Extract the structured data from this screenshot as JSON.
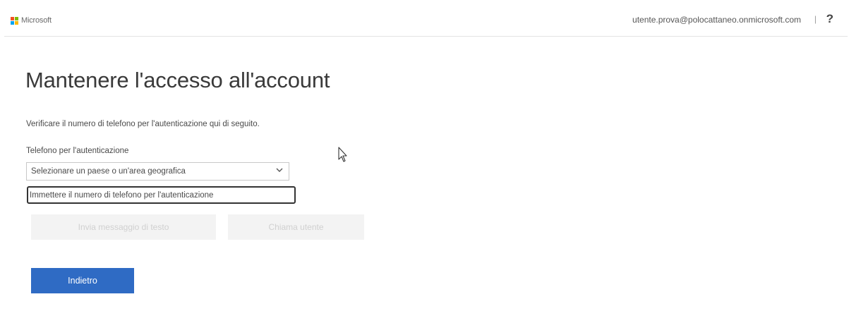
{
  "header": {
    "brand": "Microsoft",
    "user_email": "utente.prova@polocattaneo.onmicrosoft.com",
    "separator": "|",
    "help": "?"
  },
  "main": {
    "title": "Mantenere l'accesso all'account",
    "description": "Verificare il numero di telefono per l'autenticazione qui di seguito.",
    "phone_label": "Telefono per l'autenticazione",
    "country_select": {
      "value": "Selezionare un paese o un'area geografica"
    },
    "phone_input": {
      "value": "",
      "placeholder": "Immettere il numero di telefono per l'autenticazione"
    },
    "buttons": {
      "send_text": "Invia messaggio di testo",
      "call": "Chiama utente",
      "back": "Indietro"
    }
  },
  "colors": {
    "accent": "#2f6bc4",
    "disabled_bg": "#f3f3f3",
    "disabled_text": "#d0d0d0"
  },
  "icons": [
    "microsoft-logo-icon",
    "chevron-down-icon",
    "mouse-pointer-icon"
  ]
}
